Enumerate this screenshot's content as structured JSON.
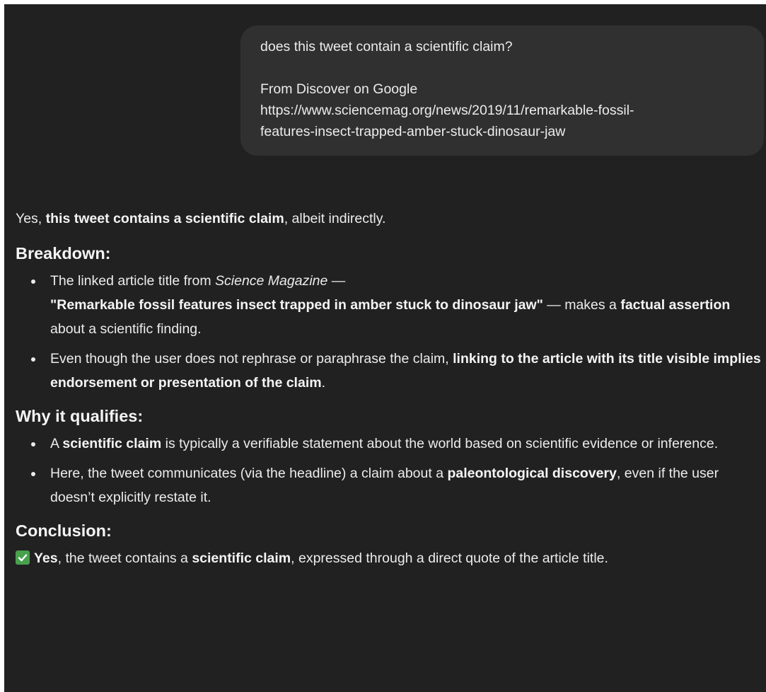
{
  "user_message": {
    "line1": "does this tweet contain a scientific claim?",
    "line2": "From Discover on Google",
    "url_line1": "https://www.sciencemag.org/news/2019/11/remarkable-fossil-",
    "url_line2": "features-insect-trapped-amber-stuck-dinosaur-jaw"
  },
  "response": {
    "intro": {
      "prefix": "Yes, ",
      "bold": "this tweet contains a scientific claim",
      "suffix": ", albeit indirectly."
    },
    "breakdown": {
      "heading": "Breakdown:",
      "item1": {
        "t1": "The linked article title from ",
        "italic": "Science Magazine",
        "t2": " —",
        "quote": "\"Remarkable fossil features insect trapped in amber stuck to dinosaur jaw\"",
        "t3": " — makes a ",
        "bold": "factual assertion",
        "t4": " about a scientific finding."
      },
      "item2": {
        "t1": "Even though the user does not rephrase or paraphrase the claim, ",
        "bold": "linking to the article with its title visible implies endorsement or presentation of the claim",
        "t2": "."
      }
    },
    "why": {
      "heading": "Why it qualifies:",
      "item1": {
        "t1": "A ",
        "bold": "scientific claim",
        "t2": " is typically a verifiable statement about the world based on scientific evidence or inference."
      },
      "item2": {
        "t1": "Here, the tweet communicates (via the headline) a claim about a ",
        "bold": "paleontological discovery",
        "t2": ", even if the user doesn’t explicitly restate it."
      }
    },
    "conclusion": {
      "heading": "Conclusion:",
      "icon": "check-mark-button-icon",
      "bold1": "Yes",
      "t1": ", the tweet contains a ",
      "bold2": "scientific claim",
      "t2": ", expressed through a direct quote of the article title."
    }
  },
  "colors": {
    "page_background": "#212121",
    "user_bubble": "#303030",
    "text": "#ececec",
    "check_green": "#48a14d"
  }
}
